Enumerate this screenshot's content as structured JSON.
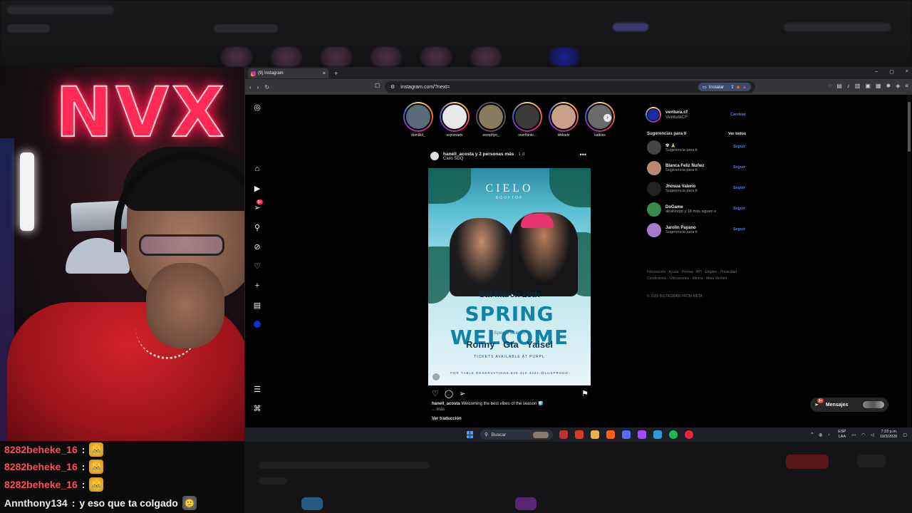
{
  "stream": {
    "neon_sign": "NVX",
    "chat": [
      {
        "user": "8282beheke_16",
        "sep": ":",
        "emote": "lol-emote",
        "message": ""
      },
      {
        "user": "8282beheke_16",
        "sep": ":",
        "emote": "lol-emote",
        "message": ""
      },
      {
        "user": "8282beheke_16",
        "sep": ":",
        "emote": "lol-emote",
        "message": ""
      },
      {
        "user": "Annthony134",
        "sep": ":",
        "emote": "",
        "message": "y eso que ta colgado"
      }
    ]
  },
  "browser": {
    "tab_title": "(9) Instagram",
    "tab_close": "×",
    "new_tab": "+",
    "url": "instagram.com/?next=",
    "install_label": "Instalar",
    "window_controls": [
      "–",
      "▢",
      "×"
    ]
  },
  "instagram": {
    "nav_badge": "9+",
    "stories": [
      {
        "name": "domiilol_",
        "color": "#5a6a7a"
      },
      {
        "name": "soyomartv",
        "color": "#e8e8e8"
      },
      {
        "name": "eemphyc_",
        "color": "#8a7a60"
      },
      {
        "name": "overthinki...",
        "color": "#3a3a3a"
      },
      {
        "name": "ikhloetv",
        "color": "#c9a08a"
      },
      {
        "name": "kattsss",
        "color": "#6a6a6a"
      }
    ],
    "post": {
      "header": "hanell_acosta y 2 personas más",
      "time": "· 1 d",
      "location": "Cielo SDQ",
      "poster": {
        "brand": "CIELO",
        "brand_sub": "ROOFTOP",
        "date": "Sat March 28th",
        "headline": "SPRING WELCOME",
        "guests_label": "Special Guests",
        "artists": "Ronny Gta  Yaisel",
        "tickets": "TICKETS AVAILABLE AT  PURPL",
        "footer": "FOR TABLE RESERVATIONS:849-310-4321  @LUXPRODD"
      },
      "caption_user": "hanell_acosta",
      "caption_text": "Welcoming the best vibes of the season 🧊",
      "caption_more": "... más",
      "translate": "Ver traducción"
    },
    "account": {
      "username": "ventura.cf",
      "fullname": "VenturaCF",
      "switch": "Cambiar"
    },
    "suggestions_title": "Sugerencias para ti",
    "see_all": "Ver todos",
    "suggestions": [
      {
        "name": "☢ 🙏",
        "sub": "Sugerencia para ti",
        "action": "Seguir",
        "color": "#444"
      },
      {
        "name": "Blanca Feliz Nuñez",
        "sub": "Sugerencia para ti",
        "action": "Seguir",
        "color": "#b88870"
      },
      {
        "name": "Jhosua Valerio",
        "sub": "Sugerencia para ti",
        "action": "Seguir",
        "color": "#222"
      },
      {
        "name": "DoGame",
        "sub": "alcalvorpp y 18 más siguen e",
        "action": "Seguir",
        "color": "#3a8a4a"
      },
      {
        "name": "Jarolin Payano",
        "sub": "Sugerencia para ti",
        "action": "Seguir",
        "color": "#a77ad0"
      }
    ],
    "footer_links": "Información · Ayuda · Prensa · API · Empleo · Privacidad · Condiciones · Ubicaciones · Idioma · Meta Verified",
    "copyright": "© 2026 INSTAGRAM FROM META",
    "messages_label": "Mensajes",
    "messages_badge": "9+"
  },
  "taskbar": {
    "search_placeholder": "Buscar",
    "lang": "ESP",
    "lang_sub": "LAA",
    "time": "7:23 p.m.",
    "date": "19/3/2026",
    "apps": [
      "#c03030",
      "#d83a2a",
      "#e8b440",
      "#ff5c1a",
      "#5a6aff",
      "#a04aff",
      "#2a9ad8",
      "#1db954",
      "#e8283a"
    ]
  }
}
